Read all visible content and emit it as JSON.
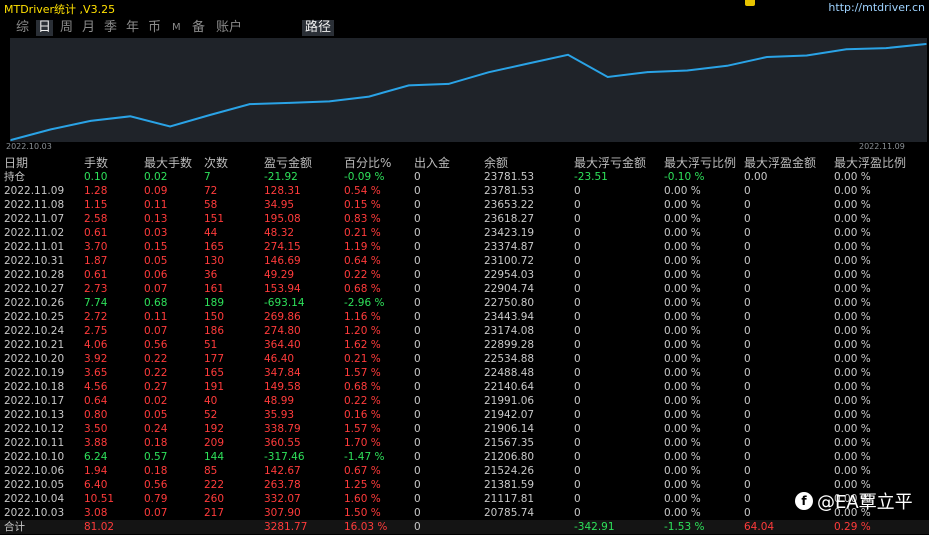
{
  "window": {
    "title": "MTDriver统计 ,V3.25",
    "link": "http://mtdriver.cn"
  },
  "tabs": [
    "综",
    "日",
    "周",
    "月",
    "季",
    "年",
    "币",
    "M",
    "备",
    "账户",
    "路径"
  ],
  "active_tabs": [
    "日",
    "路径"
  ],
  "chart": {
    "start_date": "2022.10.03",
    "end_date": "2022.11.09",
    "line_color": "#2aa3e6"
  },
  "chart_data": {
    "type": "line",
    "x": [
      "2022.10.03",
      "2022.10.04",
      "2022.10.05",
      "2022.10.06",
      "2022.10.10",
      "2022.10.11",
      "2022.10.12",
      "2022.10.13",
      "2022.10.17",
      "2022.10.18",
      "2022.10.19",
      "2022.10.20",
      "2022.10.21",
      "2022.10.24",
      "2022.10.25",
      "2022.10.26",
      "2022.10.27",
      "2022.10.28",
      "2022.10.31",
      "2022.11.01",
      "2022.11.02",
      "2022.11.07",
      "2022.11.08",
      "2022.11.09"
    ],
    "values": [
      20785.74,
      21117.81,
      21381.59,
      21524.26,
      21206.8,
      21567.35,
      21906.14,
      21942.07,
      21991.06,
      22140.64,
      22488.48,
      22534.88,
      22899.28,
      23174.08,
      23443.94,
      22750.8,
      22904.74,
      22954.03,
      23100.72,
      23374.87,
      23423.19,
      23618.27,
      23653.22,
      23781.53
    ],
    "xlabel": "",
    "ylabel": "",
    "grid": false
  },
  "columns": [
    "日期",
    "手数",
    "最大手数",
    "次数",
    "盈亏金额",
    "百分比%",
    "出入金",
    "余额",
    "最大浮亏金额",
    "最大浮亏比例",
    "最大浮盈金额",
    "最大浮盈比例"
  ],
  "holding": {
    "label": "持仓",
    "lots": "0.10",
    "max_lots": "0.02",
    "count": "7",
    "pnl": "-21.92",
    "pct": "-0.09 %",
    "flow": "0",
    "balance": "23781.53",
    "max_float_loss": "-23.51",
    "max_float_loss_pct": "-0.10 %",
    "max_float_profit": "0.00",
    "max_float_profit_pct": "0.00 %"
  },
  "rows": [
    {
      "date": "2022.11.09",
      "lots": "1.28",
      "max_lots": "0.09",
      "count": "72",
      "pnl": "128.31",
      "pct": "0.54 %",
      "flow": "0",
      "balance": "23781.53",
      "mfl": "0",
      "mflp": "0.00 %",
      "mfp": "0",
      "mfpp": "0.00 %",
      "sign": "pos"
    },
    {
      "date": "2022.11.08",
      "lots": "1.15",
      "max_lots": "0.11",
      "count": "58",
      "pnl": "34.95",
      "pct": "0.15 %",
      "flow": "0",
      "balance": "23653.22",
      "mfl": "0",
      "mflp": "0.00 %",
      "mfp": "0",
      "mfpp": "0.00 %",
      "sign": "pos"
    },
    {
      "date": "2022.11.07",
      "lots": "2.58",
      "max_lots": "0.13",
      "count": "151",
      "pnl": "195.08",
      "pct": "0.83 %",
      "flow": "0",
      "balance": "23618.27",
      "mfl": "0",
      "mflp": "0.00 %",
      "mfp": "0",
      "mfpp": "0.00 %",
      "sign": "pos"
    },
    {
      "date": "2022.11.02",
      "lots": "0.61",
      "max_lots": "0.03",
      "count": "44",
      "pnl": "48.32",
      "pct": "0.21 %",
      "flow": "0",
      "balance": "23423.19",
      "mfl": "0",
      "mflp": "0.00 %",
      "mfp": "0",
      "mfpp": "0.00 %",
      "sign": "pos"
    },
    {
      "date": "2022.11.01",
      "lots": "3.70",
      "max_lots": "0.15",
      "count": "165",
      "pnl": "274.15",
      "pct": "1.19 %",
      "flow": "0",
      "balance": "23374.87",
      "mfl": "0",
      "mflp": "0.00 %",
      "mfp": "0",
      "mfpp": "0.00 %",
      "sign": "pos"
    },
    {
      "date": "2022.10.31",
      "lots": "1.87",
      "max_lots": "0.05",
      "count": "130",
      "pnl": "146.69",
      "pct": "0.64 %",
      "flow": "0",
      "balance": "23100.72",
      "mfl": "0",
      "mflp": "0.00 %",
      "mfp": "0",
      "mfpp": "0.00 %",
      "sign": "pos"
    },
    {
      "date": "2022.10.28",
      "lots": "0.61",
      "max_lots": "0.06",
      "count": "36",
      "pnl": "49.29",
      "pct": "0.22 %",
      "flow": "0",
      "balance": "22954.03",
      "mfl": "0",
      "mflp": "0.00 %",
      "mfp": "0",
      "mfpp": "0.00 %",
      "sign": "pos"
    },
    {
      "date": "2022.10.27",
      "lots": "2.73",
      "max_lots": "0.07",
      "count": "161",
      "pnl": "153.94",
      "pct": "0.68 %",
      "flow": "0",
      "balance": "22904.74",
      "mfl": "0",
      "mflp": "0.00 %",
      "mfp": "0",
      "mfpp": "0.00 %",
      "sign": "pos"
    },
    {
      "date": "2022.10.26",
      "lots": "7.74",
      "max_lots": "0.68",
      "count": "189",
      "pnl": "-693.14",
      "pct": "-2.96 %",
      "flow": "0",
      "balance": "22750.80",
      "mfl": "0",
      "mflp": "0.00 %",
      "mfp": "0",
      "mfpp": "0.00 %",
      "sign": "neg"
    },
    {
      "date": "2022.10.25",
      "lots": "2.72",
      "max_lots": "0.11",
      "count": "150",
      "pnl": "269.86",
      "pct": "1.16 %",
      "flow": "0",
      "balance": "23443.94",
      "mfl": "0",
      "mflp": "0.00 %",
      "mfp": "0",
      "mfpp": "0.00 %",
      "sign": "pos"
    },
    {
      "date": "2022.10.24",
      "lots": "2.75",
      "max_lots": "0.07",
      "count": "186",
      "pnl": "274.80",
      "pct": "1.20 %",
      "flow": "0",
      "balance": "23174.08",
      "mfl": "0",
      "mflp": "0.00 %",
      "mfp": "0",
      "mfpp": "0.00 %",
      "sign": "pos"
    },
    {
      "date": "2022.10.21",
      "lots": "4.06",
      "max_lots": "0.56",
      "count": "51",
      "pnl": "364.40",
      "pct": "1.62 %",
      "flow": "0",
      "balance": "22899.28",
      "mfl": "0",
      "mflp": "0.00 %",
      "mfp": "0",
      "mfpp": "0.00 %",
      "sign": "pos"
    },
    {
      "date": "2022.10.20",
      "lots": "3.92",
      "max_lots": "0.22",
      "count": "177",
      "pnl": "46.40",
      "pct": "0.21 %",
      "flow": "0",
      "balance": "22534.88",
      "mfl": "0",
      "mflp": "0.00 %",
      "mfp": "0",
      "mfpp": "0.00 %",
      "sign": "pos"
    },
    {
      "date": "2022.10.19",
      "lots": "3.65",
      "max_lots": "0.22",
      "count": "165",
      "pnl": "347.84",
      "pct": "1.57 %",
      "flow": "0",
      "balance": "22488.48",
      "mfl": "0",
      "mflp": "0.00 %",
      "mfp": "0",
      "mfpp": "0.00 %",
      "sign": "pos"
    },
    {
      "date": "2022.10.18",
      "lots": "4.56",
      "max_lots": "0.27",
      "count": "191",
      "pnl": "149.58",
      "pct": "0.68 %",
      "flow": "0",
      "balance": "22140.64",
      "mfl": "0",
      "mflp": "0.00 %",
      "mfp": "0",
      "mfpp": "0.00 %",
      "sign": "pos"
    },
    {
      "date": "2022.10.17",
      "lots": "0.64",
      "max_lots": "0.02",
      "count": "40",
      "pnl": "48.99",
      "pct": "0.22 %",
      "flow": "0",
      "balance": "21991.06",
      "mfl": "0",
      "mflp": "0.00 %",
      "mfp": "0",
      "mfpp": "0.00 %",
      "sign": "pos"
    },
    {
      "date": "2022.10.13",
      "lots": "0.80",
      "max_lots": "0.05",
      "count": "52",
      "pnl": "35.93",
      "pct": "0.16 %",
      "flow": "0",
      "balance": "21942.07",
      "mfl": "0",
      "mflp": "0.00 %",
      "mfp": "0",
      "mfpp": "0.00 %",
      "sign": "pos"
    },
    {
      "date": "2022.10.12",
      "lots": "3.50",
      "max_lots": "0.24",
      "count": "192",
      "pnl": "338.79",
      "pct": "1.57 %",
      "flow": "0",
      "balance": "21906.14",
      "mfl": "0",
      "mflp": "0.00 %",
      "mfp": "0",
      "mfpp": "0.00 %",
      "sign": "pos"
    },
    {
      "date": "2022.10.11",
      "lots": "3.88",
      "max_lots": "0.18",
      "count": "209",
      "pnl": "360.55",
      "pct": "1.70 %",
      "flow": "0",
      "balance": "21567.35",
      "mfl": "0",
      "mflp": "0.00 %",
      "mfp": "0",
      "mfpp": "0.00 %",
      "sign": "pos"
    },
    {
      "date": "2022.10.10",
      "lots": "6.24",
      "max_lots": "0.57",
      "count": "144",
      "pnl": "-317.46",
      "pct": "-1.47 %",
      "flow": "0",
      "balance": "21206.80",
      "mfl": "0",
      "mflp": "0.00 %",
      "mfp": "0",
      "mfpp": "0.00 %",
      "sign": "neg"
    },
    {
      "date": "2022.10.06",
      "lots": "1.94",
      "max_lots": "0.18",
      "count": "85",
      "pnl": "142.67",
      "pct": "0.67 %",
      "flow": "0",
      "balance": "21524.26",
      "mfl": "0",
      "mflp": "0.00 %",
      "mfp": "0",
      "mfpp": "0.00 %",
      "sign": "pos"
    },
    {
      "date": "2022.10.05",
      "lots": "6.40",
      "max_lots": "0.56",
      "count": "222",
      "pnl": "263.78",
      "pct": "1.25 %",
      "flow": "0",
      "balance": "21381.59",
      "mfl": "0",
      "mflp": "0.00 %",
      "mfp": "0",
      "mfpp": "0.00 %",
      "sign": "pos"
    },
    {
      "date": "2022.10.04",
      "lots": "10.51",
      "max_lots": "0.79",
      "count": "260",
      "pnl": "332.07",
      "pct": "1.60 %",
      "flow": "0",
      "balance": "21117.81",
      "mfl": "0",
      "mflp": "0.00 %",
      "mfp": "0",
      "mfpp": "0.00 %",
      "sign": "pos"
    },
    {
      "date": "2022.10.03",
      "lots": "3.08",
      "max_lots": "0.07",
      "count": "217",
      "pnl": "307.90",
      "pct": "1.50 %",
      "flow": "0",
      "balance": "20785.74",
      "mfl": "0",
      "mflp": "0.00 %",
      "mfp": "0",
      "mfpp": "0.00 %",
      "sign": "pos"
    }
  ],
  "total": {
    "label": "合计",
    "lots": "81.02",
    "pnl": "3281.77",
    "pct": "16.03 %",
    "flow": "0",
    "max_float_loss": "-342.91",
    "max_float_loss_pct": "-1.53 %",
    "max_float_profit": "64.04",
    "max_float_profit_pct": "0.29 %"
  },
  "watermark": {
    "text": "@EA覃立平",
    "logo": "f"
  }
}
